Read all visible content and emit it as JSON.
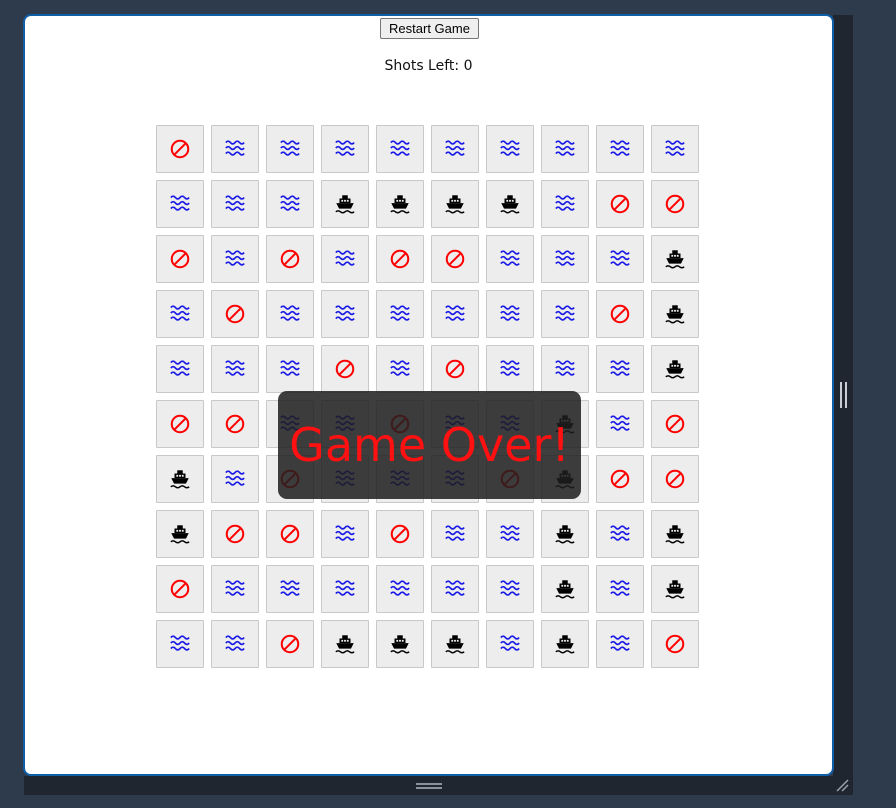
{
  "app": {
    "restart_label": "Restart Game",
    "shots_label": "Shots Left: 0",
    "overlay_text": "Game Over!"
  },
  "colors": {
    "miss": "#ff0000",
    "water": "#1a1ae6",
    "ship": "#000000",
    "panel_border": "#0e5fa8",
    "overlay_text": "#ff1111"
  },
  "legend": {
    "W": "water-icon",
    "M": "miss-icon",
    "S": "ship-icon"
  },
  "board": {
    "rows": [
      [
        "M",
        "W",
        "W",
        "W",
        "W",
        "W",
        "W",
        "W",
        "W",
        "W"
      ],
      [
        "W",
        "W",
        "W",
        "S",
        "S",
        "S",
        "S",
        "W",
        "M",
        "M"
      ],
      [
        "M",
        "W",
        "M",
        "W",
        "M",
        "M",
        "W",
        "W",
        "W",
        "S"
      ],
      [
        "W",
        "M",
        "W",
        "W",
        "W",
        "W",
        "W",
        "W",
        "M",
        "S"
      ],
      [
        "W",
        "W",
        "W",
        "M",
        "W",
        "M",
        "W",
        "W",
        "W",
        "S"
      ],
      [
        "M",
        "M",
        "W",
        "W",
        "M",
        "W",
        "W",
        "S",
        "W",
        "M"
      ],
      [
        "S",
        "W",
        "M",
        "W",
        "W",
        "W",
        "M",
        "S",
        "M",
        "M"
      ],
      [
        "S",
        "M",
        "M",
        "W",
        "M",
        "W",
        "W",
        "S",
        "W",
        "S"
      ],
      [
        "M",
        "W",
        "W",
        "W",
        "W",
        "W",
        "W",
        "S",
        "W",
        "S"
      ],
      [
        "W",
        "W",
        "M",
        "S",
        "S",
        "S",
        "W",
        "S",
        "W",
        "M"
      ]
    ]
  }
}
